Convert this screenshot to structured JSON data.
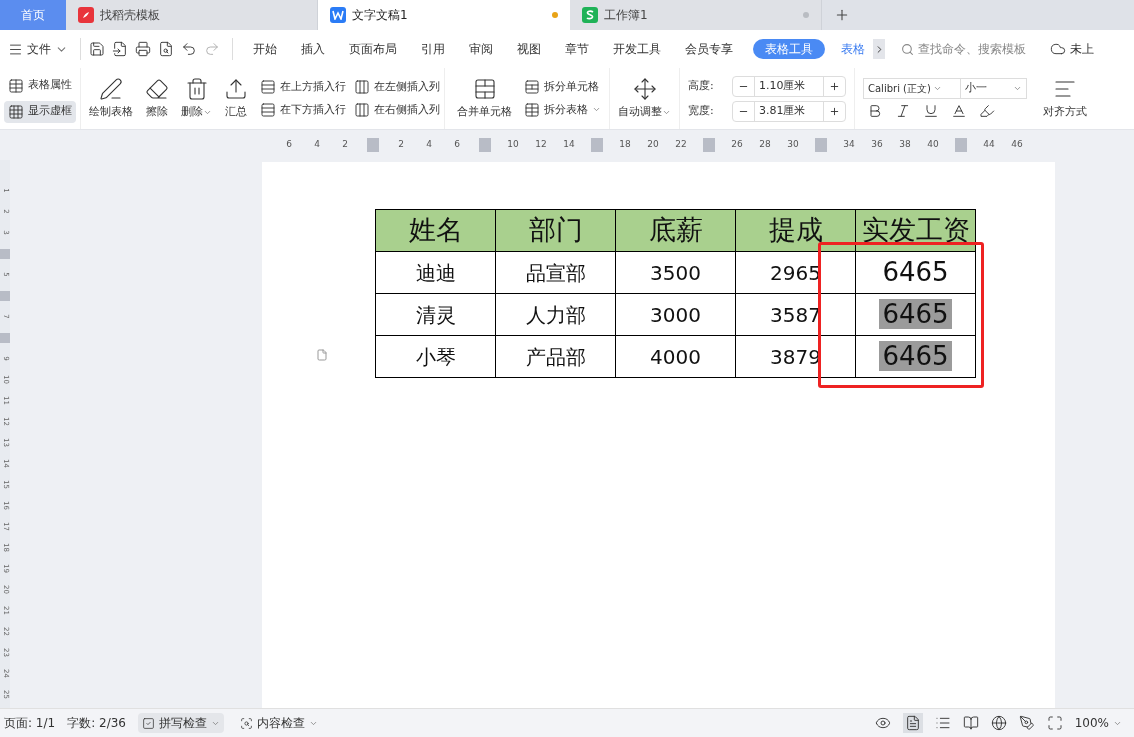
{
  "tabs": [
    {
      "label": "首页",
      "kind": "home",
      "selected": false
    },
    {
      "label": "找稻壳模板",
      "kind": "docer",
      "selected": false
    },
    {
      "label": "文字文稿1",
      "kind": "writer",
      "selected": true,
      "modified": true
    },
    {
      "label": "工作簿1",
      "kind": "sheet",
      "selected": false,
      "modified": false
    }
  ],
  "menu": {
    "file": "文件",
    "tabs": [
      {
        "label": "开始",
        "selected": false
      },
      {
        "label": "插入",
        "selected": false
      },
      {
        "label": "页面布局",
        "selected": false
      },
      {
        "label": "引用",
        "selected": false
      },
      {
        "label": "审阅",
        "selected": false
      },
      {
        "label": "视图",
        "selected": false
      },
      {
        "label": "章节",
        "selected": false
      },
      {
        "label": "开发工具",
        "selected": false
      },
      {
        "label": "会员专享",
        "selected": false
      },
      {
        "label": "表格工具",
        "selected": true
      },
      {
        "label": "表格",
        "selected": false
      }
    ],
    "search": {
      "placeholder": "查找命令、搜索模板"
    },
    "cloud": "未上"
  },
  "ribbon": {
    "table_props": "表格属性",
    "show_grid": {
      "label": "显示虚框",
      "selected": true
    },
    "draw": "绘制表格",
    "erase": "擦除",
    "delete": "删除",
    "summary": "汇总",
    "insert_above": "在上方插入行",
    "insert_below": "在下方插入行",
    "insert_left": "在左侧插入列",
    "insert_right": "在右侧插入列",
    "merge": "合并单元格",
    "split_cells": "拆分单元格",
    "split_table": "拆分表格",
    "autofit": "自动调整",
    "height": {
      "label": "高度:",
      "value": "1.10厘米"
    },
    "width": {
      "label": "宽度:",
      "value": "3.81厘米"
    },
    "font": "Calibri (正文)",
    "size": "小一",
    "align": "对齐方式"
  },
  "ruler": [
    {
      "kind": "number",
      "label": "6"
    },
    {
      "kind": "number",
      "label": "4"
    },
    {
      "kind": "number",
      "label": "2"
    },
    {
      "kind": "marker"
    },
    {
      "kind": "number",
      "label": "2"
    },
    {
      "kind": "number",
      "label": "4"
    },
    {
      "kind": "number",
      "label": "6"
    },
    {
      "kind": "marker"
    },
    {
      "kind": "number",
      "label": "10"
    },
    {
      "kind": "number",
      "label": "12"
    },
    {
      "kind": "number",
      "label": "14"
    },
    {
      "kind": "marker"
    },
    {
      "kind": "number",
      "label": "18"
    },
    {
      "kind": "number",
      "label": "20"
    },
    {
      "kind": "number",
      "label": "22"
    },
    {
      "kind": "marker"
    },
    {
      "kind": "number",
      "label": "26"
    },
    {
      "kind": "number",
      "label": "28"
    },
    {
      "kind": "number",
      "label": "30"
    },
    {
      "kind": "marker"
    },
    {
      "kind": "number",
      "label": "34"
    },
    {
      "kind": "number",
      "label": "36"
    },
    {
      "kind": "number",
      "label": "38"
    },
    {
      "kind": "number",
      "label": "40"
    },
    {
      "kind": "marker"
    },
    {
      "kind": "number",
      "label": "44"
    },
    {
      "kind": "number",
      "label": "46"
    }
  ],
  "vruler": [
    {
      "kind": "number",
      "label": "1"
    },
    {
      "kind": "number",
      "label": "2"
    },
    {
      "kind": "number",
      "label": "3"
    },
    {
      "kind": "marker"
    },
    {
      "kind": "number",
      "label": "5"
    },
    {
      "kind": "marker"
    },
    {
      "kind": "number",
      "label": "7"
    },
    {
      "kind": "marker"
    },
    {
      "kind": "number",
      "label": "9"
    },
    {
      "kind": "number",
      "label": "10"
    },
    {
      "kind": "number",
      "label": "11"
    },
    {
      "kind": "number",
      "label": "12"
    },
    {
      "kind": "number",
      "label": "13"
    },
    {
      "kind": "number",
      "label": "14"
    },
    {
      "kind": "number",
      "label": "15"
    },
    {
      "kind": "number",
      "label": "16"
    },
    {
      "kind": "number",
      "label": "17"
    },
    {
      "kind": "number",
      "label": "18"
    },
    {
      "kind": "number",
      "label": "19"
    },
    {
      "kind": "number",
      "label": "20"
    },
    {
      "kind": "number",
      "label": "21"
    },
    {
      "kind": "number",
      "label": "22"
    },
    {
      "kind": "number",
      "label": "23"
    },
    {
      "kind": "number",
      "label": "24"
    },
    {
      "kind": "number",
      "label": "25"
    }
  ],
  "table": {
    "callout_box": true,
    "header": [
      "姓名",
      "部门",
      "底薪",
      "提成",
      "实发工资"
    ],
    "rows": [
      {
        "cells": [
          {
            "text": "迪迪",
            "highlighted": false
          },
          {
            "text": "品宣部",
            "highlighted": false
          },
          {
            "text": "3500",
            "highlighted": false
          },
          {
            "text": "2965",
            "highlighted": false
          },
          {
            "text": "6465",
            "highlighted": false
          }
        ]
      },
      {
        "cells": [
          {
            "text": "清灵",
            "highlighted": false
          },
          {
            "text": "人力部",
            "highlighted": false
          },
          {
            "text": "3000",
            "highlighted": false
          },
          {
            "text": "3587",
            "highlighted": false
          },
          {
            "text": "6465",
            "highlighted": true
          }
        ]
      },
      {
        "cells": [
          {
            "text": "小琴",
            "highlighted": false
          },
          {
            "text": "产品部",
            "highlighted": false
          },
          {
            "text": "4000",
            "highlighted": false
          },
          {
            "text": "3879",
            "highlighted": false
          },
          {
            "text": "6465",
            "highlighted": true
          }
        ]
      }
    ]
  },
  "status": {
    "page": "页面: 1/1",
    "words": "字数: 2/36",
    "spell": "拼写检查",
    "content_check": "内容检查",
    "zoom": "100%"
  }
}
